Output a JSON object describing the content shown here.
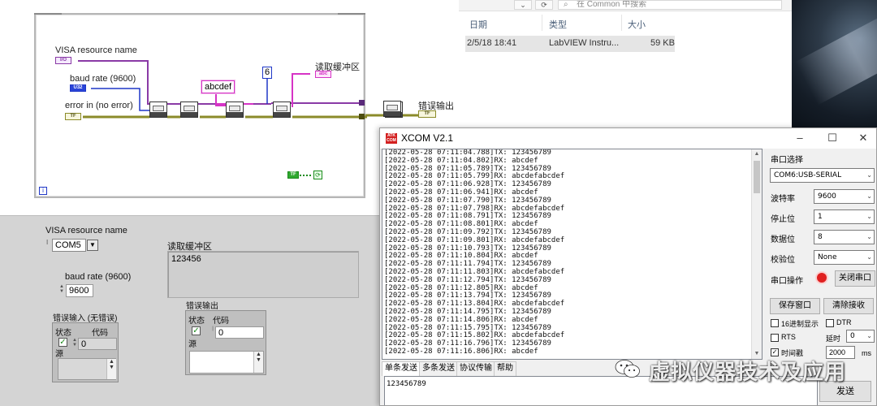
{
  "explorer": {
    "search_placeholder": "在 Common 中搜索",
    "headers": [
      "日期",
      "类型",
      "大小"
    ],
    "file": {
      "date": "2/5/18 18:41",
      "type": "LabVIEW Instru...",
      "size": "59 KB"
    }
  },
  "block_diagram": {
    "visa_label": "VISA resource name",
    "visa_term": "I/O",
    "baud_label": "baud rate (9600)",
    "baud_term": "U32",
    "error_label": "error in (no error)",
    "error_term": "TF",
    "write_string": "abcdef",
    "read_count": "6",
    "read_buffer_label": "读取缓冲区",
    "read_buffer_term": "abc",
    "error_out_label": "错误输出",
    "error_out_term": "TF",
    "loop_index": "i",
    "stop_term": "TF"
  },
  "front_panel": {
    "visa_label": "VISA resource name",
    "visa_value": "COM5",
    "baud_label": "baud rate (9600)",
    "baud_value": "9600",
    "read_buffer_label": "读取缓冲区",
    "read_buffer_value": "123456",
    "error_in_label": "错误输入 (无错误)",
    "error_out_label": "错误输出",
    "status_label": "状态",
    "code_label": "代码",
    "source_label": "源",
    "error_in_code": "0",
    "error_out_code": "0"
  },
  "xcom": {
    "title": "XCOM V2.1",
    "icon_text": "ATK COM",
    "log": [
      "[2022-05-28 07:11:04.788]TX: 123456789",
      "[2022-05-28 07:11:04.802]RX: abcdef",
      "[2022-05-28 07:11:05.789]TX: 123456789",
      "[2022-05-28 07:11:05.799]RX: abcdefabcdef",
      "[2022-05-28 07:11:06.928]TX: 123456789",
      "[2022-05-28 07:11:06.941]RX: abcdef",
      "[2022-05-28 07:11:07.790]TX: 123456789",
      "[2022-05-28 07:11:07.798]RX: abcdefabcdef",
      "[2022-05-28 07:11:08.791]TX: 123456789",
      "[2022-05-28 07:11:08.801]RX: abcdef",
      "[2022-05-28 07:11:09.792]TX: 123456789",
      "[2022-05-28 07:11:09.801]RX: abcdefabcdef",
      "[2022-05-28 07:11:10.793]TX: 123456789",
      "[2022-05-28 07:11:10.804]RX: abcdef",
      "[2022-05-28 07:11:11.794]TX: 123456789",
      "[2022-05-28 07:11:11.803]RX: abcdefabcdef",
      "[2022-05-28 07:11:12.794]TX: 123456789",
      "[2022-05-28 07:11:12.805]RX: abcdef",
      "[2022-05-28 07:11:13.794]TX: 123456789",
      "[2022-05-28 07:11:13.804]RX: abcdefabcdef",
      "[2022-05-28 07:11:14.795]TX: 123456789",
      "[2022-05-28 07:11:14.806]RX: abcdef",
      "[2022-05-28 07:11:15.795]TX: 123456789",
      "[2022-05-28 07:11:15.802]RX: abcdefabcdef",
      "[2022-05-28 07:11:16.796]TX: 123456789",
      "[2022-05-28 07:11:16.806]RX: abcdef"
    ],
    "tabs": [
      "单条发送",
      "多条发送",
      "协议传输",
      "帮助"
    ],
    "send_text": "123456789",
    "send_button": "发送",
    "panel": {
      "port_select_label": "串口选择",
      "port_value": "COM6:USB-SERIAL",
      "baud_label": "波特率",
      "baud_value": "9600",
      "stop_label": "停止位",
      "stop_value": "1",
      "data_label": "数据位",
      "data_value": "8",
      "parity_label": "校验位",
      "parity_value": "None",
      "op_label": "串口操作",
      "close_port": "关闭串口",
      "save_window": "保存窗口",
      "clear_recv": "清除接收",
      "hex_display": "16进制显示",
      "dtr": "DTR",
      "rts": "RTS",
      "delay_label": "延时",
      "delay_value": "0",
      "timestamp": "时间戳",
      "timestamp_value": "2000",
      "ms": "ms"
    }
  },
  "watermark": "虚拟仪器技术及应用",
  "colors": {
    "string_wire": "#d633c6",
    "numeric_wire": "#1f37c7",
    "error_wire": "#8b8b2a",
    "led_red": "#e02020",
    "check_green": "#1a8a1a"
  }
}
